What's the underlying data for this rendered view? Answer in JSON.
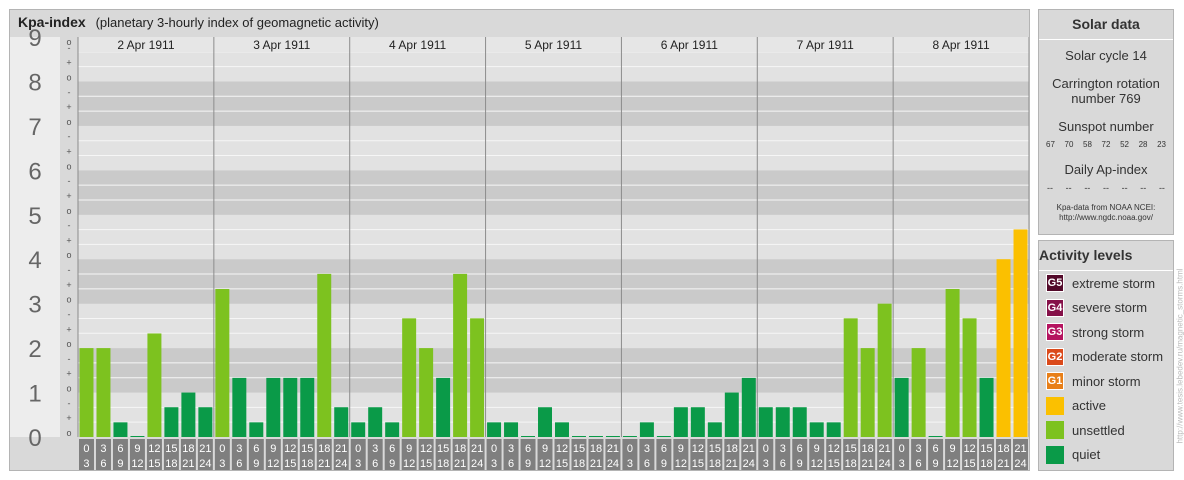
{
  "header": {
    "title": "Kpa-index",
    "subtitle": "(planetary 3-hourly index of geomagnetic activity)"
  },
  "chart_data": {
    "type": "bar",
    "ylim": [
      0,
      9
    ],
    "y_ticks": [
      "0",
      "1",
      "2",
      "3",
      "4",
      "5",
      "6",
      "7",
      "8",
      "9"
    ],
    "sub_ticks": [
      "o",
      "+",
      "-"
    ],
    "days": [
      "2 Apr 1911",
      "3 Apr 1911",
      "4 Apr 1911",
      "5 Apr 1911",
      "6 Apr 1911",
      "7 Apr 1911",
      "8 Apr 1911"
    ],
    "interval_labels": [
      [
        "0",
        "3"
      ],
      [
        "3",
        "6"
      ],
      [
        "6",
        "9"
      ],
      [
        "9",
        "12"
      ],
      [
        "12",
        "15"
      ],
      [
        "15",
        "18"
      ],
      [
        "18",
        "21"
      ],
      [
        "21",
        "24"
      ]
    ],
    "values": [
      2.0,
      2.0,
      0.33,
      0,
      2.33,
      0.67,
      1.0,
      0.67,
      3.33,
      1.33,
      0.33,
      1.33,
      1.33,
      1.33,
      3.67,
      0.67,
      0.33,
      0.67,
      0.33,
      2.67,
      2.0,
      1.33,
      3.67,
      2.67,
      0.33,
      0.33,
      0,
      0.67,
      0.33,
      0,
      0,
      0,
      0,
      0.33,
      0,
      0.67,
      0.67,
      0.33,
      1.0,
      1.33,
      0.67,
      0.67,
      0.67,
      0.33,
      0.33,
      2.67,
      2.0,
      3.0,
      1.33,
      2.0,
      0,
      3.33,
      2.67,
      1.33,
      4.0,
      4.67
    ],
    "colors": {
      "quiet": "#0a9a48",
      "unsettled": "#7dc21f",
      "active": "#fbc000",
      "G1": "#e87f18",
      "G2": "#db4a1b",
      "G3": "#b5135f",
      "G4": "#851149",
      "G5": "#530a2a"
    }
  },
  "solar": {
    "heading": "Solar data",
    "cycle": "Solar cycle 14",
    "carrington_1": "Carrington rotation",
    "carrington_2": "number 769",
    "sunspot_heading": "Sunspot number",
    "sunspots": [
      "67",
      "70",
      "58",
      "72",
      "52",
      "28",
      "23"
    ],
    "ap_heading": "Daily Ap-index",
    "daily_ap": [
      "--",
      "--",
      "--",
      "--",
      "--",
      "--",
      "--"
    ],
    "note_1": "Kpa-data from NOAA NCEI:",
    "note_2": "http://www.ngdc.noaa.gov/"
  },
  "levels": {
    "heading": "Activity levels",
    "items": [
      {
        "code": "G5",
        "label": "extreme storm",
        "color": "#530a2a"
      },
      {
        "code": "G4",
        "label": "severe storm",
        "color": "#851149"
      },
      {
        "code": "G3",
        "label": "strong storm",
        "color": "#b5135f"
      },
      {
        "code": "G2",
        "label": "moderate storm",
        "color": "#db4a1b"
      },
      {
        "code": "G1",
        "label": "minor storm",
        "color": "#e87f18"
      },
      {
        "code": "",
        "label": "active",
        "color": "#fbc000"
      },
      {
        "code": "",
        "label": "unsettled",
        "color": "#7dc21f"
      },
      {
        "code": "",
        "label": "quiet",
        "color": "#0a9a48"
      }
    ]
  },
  "watermark": "http://www.tesis.lebedev.ru/magnetic_storms.html"
}
